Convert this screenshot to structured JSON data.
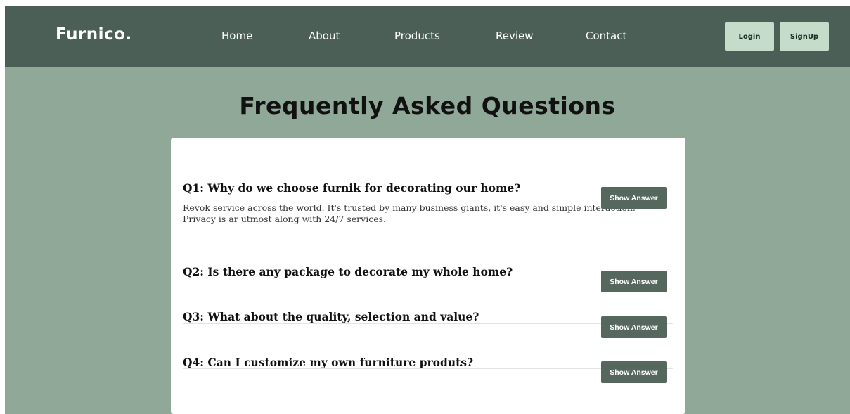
{
  "navbar": {
    "brand": "Furnico.",
    "links": [
      "Home",
      "About",
      "Products",
      "Review",
      "Contact"
    ],
    "login_label": "Login",
    "signup_label": "SignUp"
  },
  "colors": {
    "navbar_bg": "#4b5f56",
    "page_bg": "#90a898",
    "auth_button_bg": "#c5dccb",
    "show_answer_bg": "#56675e",
    "card_bg": "#ffffff"
  },
  "page": {
    "title": "Frequently Asked Questions"
  },
  "faq": {
    "show_answer_label": "Show Answer",
    "items": [
      {
        "question": "Q1: Why do we choose furnik for decorating our home?",
        "answer": "Revok service across the world. It's trusted by many business giants, it's easy and simple interaction. Privacy is ar utmost along with 24/7 services."
      },
      {
        "question": "Q2: Is there any package to decorate my whole home?"
      },
      {
        "question": "Q3: What about the quality, selection and value?"
      },
      {
        "question": "Q4: Can I customize my own furniture produts?"
      }
    ]
  }
}
